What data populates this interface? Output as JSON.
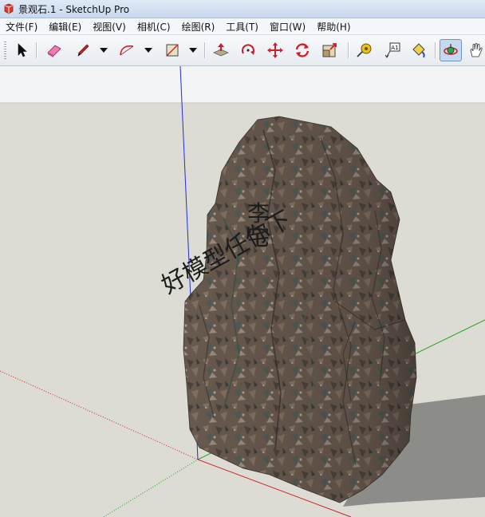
{
  "window": {
    "title": "景观石.1 - SketchUp Pro"
  },
  "menu": {
    "items": [
      "文件(F)",
      "编辑(E)",
      "视图(V)",
      "相机(C)",
      "绘图(R)",
      "工具(T)",
      "窗口(W)",
      "帮助(H)"
    ]
  },
  "toolbar": {
    "tools": [
      "select-tool",
      "eraser-tool",
      "pencil-tool",
      "arc-tool",
      "rectangle-tool",
      "push-pull-tool",
      "rotate-tool",
      "move-tool",
      "follow-me-tool",
      "scale-tool",
      "tape-measure-tool",
      "text-tool",
      "paint-bucket-tool",
      "orbit-tool",
      "pan-tool"
    ],
    "active_tool": "orbit-tool",
    "text_tool_label": "A1"
  },
  "viewport": {
    "watermark_line1": "好模型任你下",
    "watermark_line2": "李宅",
    "colors": {
      "sky": "#f2f4f5",
      "ground": "#dcdcd4",
      "axis_blue": "#1f2fd6",
      "axis_red": "#cc2020",
      "axis_green": "#1ea51e",
      "rock_base": "#6e5e52"
    }
  }
}
